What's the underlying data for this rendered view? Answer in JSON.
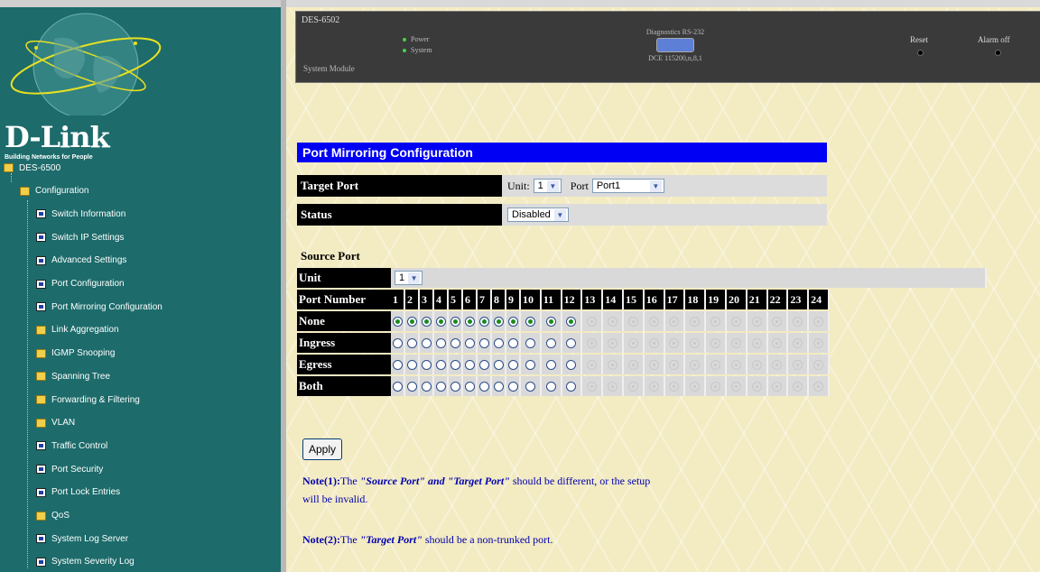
{
  "nav": {
    "logo": "D-Link",
    "tagline": "Building Networks for People",
    "tree": [
      {
        "label": "DES-6500",
        "icon": "folder-icon",
        "level": 0
      },
      {
        "label": "Configuration",
        "icon": "folder-icon",
        "level": 1
      },
      {
        "label": "Switch Information",
        "icon": "doc-icon",
        "level": 2
      },
      {
        "label": "Switch IP Settings",
        "icon": "doc-icon",
        "level": 2
      },
      {
        "label": "Advanced Settings",
        "icon": "doc-icon",
        "level": 2
      },
      {
        "label": "Port Configuration",
        "icon": "doc-icon",
        "level": 2
      },
      {
        "label": "Port Mirroring Configuration",
        "icon": "doc-icon",
        "level": 2
      },
      {
        "label": "Link Aggregation",
        "icon": "folder-icon",
        "level": 2
      },
      {
        "label": "IGMP Snooping",
        "icon": "folder-icon",
        "level": 2
      },
      {
        "label": "Spanning Tree",
        "icon": "folder-icon",
        "level": 2
      },
      {
        "label": "Forwarding & Filtering",
        "icon": "folder-icon",
        "level": 2
      },
      {
        "label": "VLAN",
        "icon": "folder-icon",
        "level": 2
      },
      {
        "label": "Traffic Control",
        "icon": "doc-icon",
        "level": 2
      },
      {
        "label": "Port Security",
        "icon": "doc-icon",
        "level": 2
      },
      {
        "label": "Port Lock Entries",
        "icon": "doc-icon",
        "level": 2
      },
      {
        "label": "QoS",
        "icon": "folder-icon",
        "level": 2
      },
      {
        "label": "System Log Server",
        "icon": "doc-icon",
        "level": 2
      },
      {
        "label": "System Severity Log",
        "icon": "doc-icon",
        "level": 2
      }
    ]
  },
  "device": {
    "model": "DES-6502",
    "system_module": "System Module",
    "led_power": "Power",
    "led_system": "System",
    "rs232_title": "Diagnostics RS-232",
    "rs232_sub": "DCE 115200,n,8,1",
    "reset": "Reset",
    "alarm_off": "Alarm off"
  },
  "config": {
    "title": "Port Mirroring Configuration",
    "target_port_label": "Target Port",
    "unit_label": "Unit:",
    "unit_value": "1",
    "port_label": "Port",
    "port_value": "Port1",
    "status_label": "Status",
    "status_value": "Disabled",
    "source_port_title": "Source Port",
    "source_unit_label": "Unit",
    "source_unit_value": "1",
    "port_number_label": "Port Number",
    "ports": [
      "1",
      "2",
      "3",
      "4",
      "5",
      "6",
      "7",
      "8",
      "9",
      "10",
      "11",
      "12",
      "13",
      "14",
      "15",
      "16",
      "17",
      "18",
      "19",
      "20",
      "21",
      "22",
      "23",
      "24"
    ],
    "active_ports": 12,
    "rows": [
      {
        "label": "None",
        "selected": true
      },
      {
        "label": "Ingress",
        "selected": false
      },
      {
        "label": "Egress",
        "selected": false
      },
      {
        "label": "Both",
        "selected": false
      }
    ],
    "apply_label": "Apply",
    "note1_prefix": "Note(1):",
    "note1_a": "The ",
    "note1_src": "\"Source Port\"",
    "note1_and": " and ",
    "note1_tgt": "\"Target Port\"",
    "note1_b": " should be different, or the setup",
    "note1_c": "will be invalid.",
    "note2_prefix": "Note(2):",
    "note2_a": "The ",
    "note2_tgt": "\"Target Port\"",
    "note2_b": " should be a non-trunked port."
  }
}
